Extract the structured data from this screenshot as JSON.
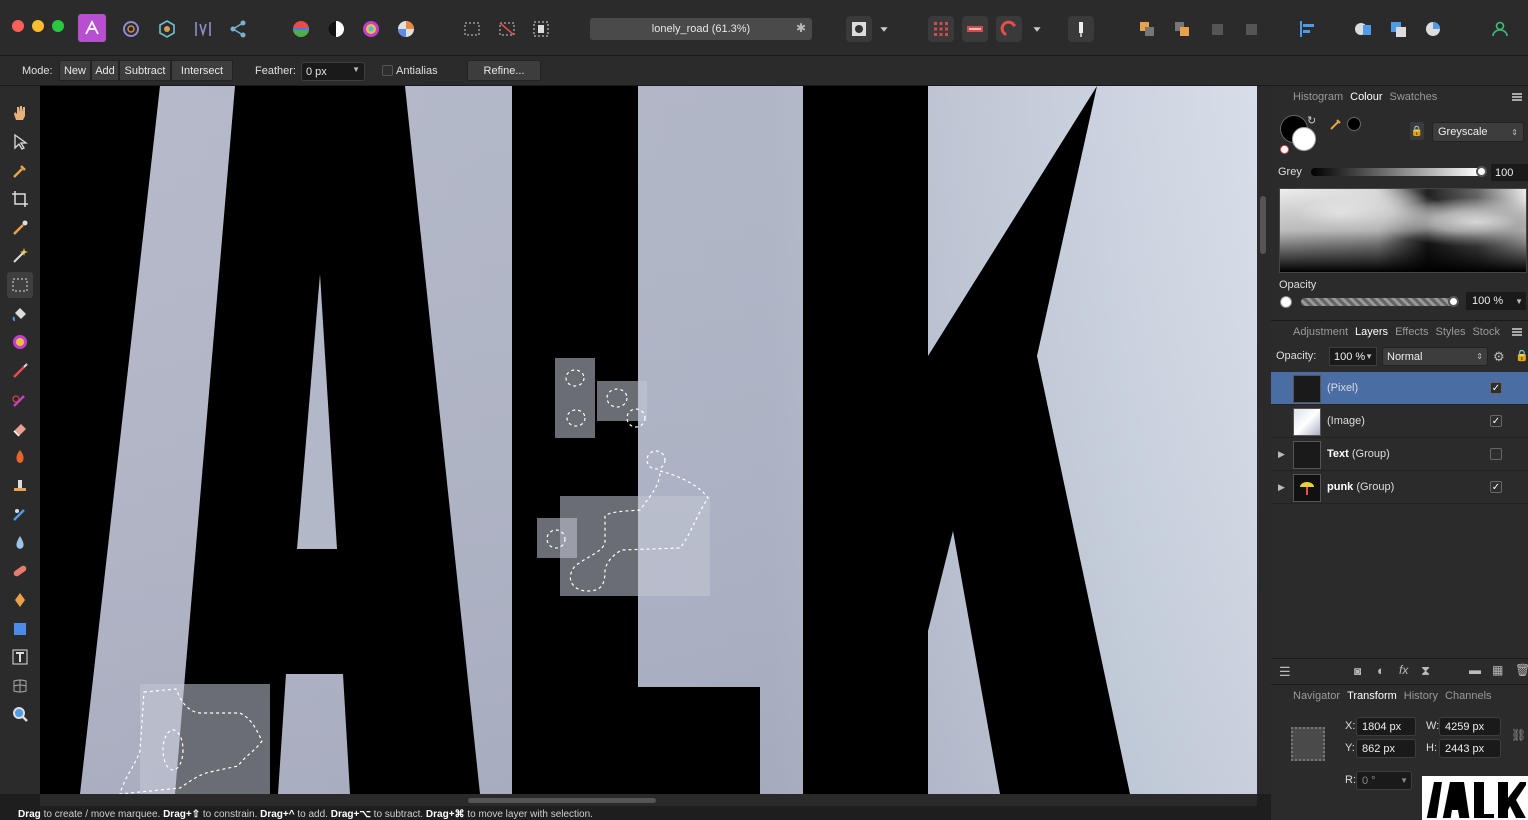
{
  "window": {
    "title": "lonely_road (61.3%)"
  },
  "toolbar": {
    "items": [
      "persona-photo-icon",
      "persona-liquify-icon",
      "persona-develop-icon",
      "persona-tonemap-icon",
      "persona-export-icon",
      "colour-wheel-icon",
      "contrast-icon",
      "hue-icon",
      "white-balance-icon",
      "marquee-icon",
      "deselect-icon",
      "invert-selection-icon",
      "quickmask-icon",
      "mask-dropdown",
      "assistant-icon",
      "snap-icon",
      "magnet-icon",
      "snap-dropdown",
      "order-back-icon",
      "order-forward-icon",
      "order-front-icon",
      "order-top-icon",
      "align-icon",
      "boolean-add-icon",
      "boolean-subtract-icon",
      "boolean-intersect-icon",
      "user-icon"
    ]
  },
  "context": {
    "mode_label": "Mode:",
    "mode_buttons": [
      "New",
      "Add",
      "Subtract",
      "Intersect"
    ],
    "feather_label": "Feather:",
    "feather_value": "0 px",
    "antialias_label": "Antialias",
    "refine_label": "Refine..."
  },
  "status": {
    "parts": [
      {
        "b": "Drag",
        "t": " to create / move marquee. "
      },
      {
        "b": "Drag+⇧",
        "t": " to constrain. "
      },
      {
        "b": "Drag+^",
        "t": " to add. "
      },
      {
        "b": "Drag+⌥",
        "t": " to subtract. "
      },
      {
        "b": "Drag+⌘",
        "t": " to move layer with selection."
      }
    ]
  },
  "colour_panel": {
    "tabs": [
      "Histogram",
      "Colour",
      "Swatches"
    ],
    "active_tab": "Colour",
    "mode": "Greyscale",
    "grey_label": "Grey",
    "grey_value": "100",
    "opacity_label": "Opacity",
    "opacity_value": "100 %"
  },
  "layers_panel": {
    "tabs": [
      "Adjustment",
      "Layers",
      "Effects",
      "Styles",
      "Stock"
    ],
    "active_tab": "Layers",
    "opacity_label": "Opacity:",
    "opacity_value": "100 %",
    "blend_mode": "Normal",
    "layers": [
      {
        "name": "",
        "type": "(Pixel)",
        "visible": true,
        "selected": true,
        "expandable": false
      },
      {
        "name": "",
        "type": "(Image)",
        "visible": true,
        "selected": false,
        "expandable": false
      },
      {
        "name": "Text",
        "type": " (Group)",
        "visible": false,
        "selected": false,
        "expandable": true
      },
      {
        "name": "punk",
        "type": " (Group)",
        "visible": true,
        "selected": false,
        "expandable": true
      }
    ]
  },
  "transform_panel": {
    "tabs": [
      "Navigator",
      "Transform",
      "History",
      "Channels"
    ],
    "active_tab": "Transform",
    "x_label": "X:",
    "x_value": "1804 px",
    "y_label": "Y:",
    "y_value": "862 px",
    "w_label": "W:",
    "w_value": "4259 px",
    "h_label": "H:",
    "h_value": "2443 px",
    "r_label": "R:",
    "r_value": "0 °"
  },
  "colors": {
    "selection_highlight": "#4a6da4",
    "canvas_sky": "#afb3c3"
  }
}
